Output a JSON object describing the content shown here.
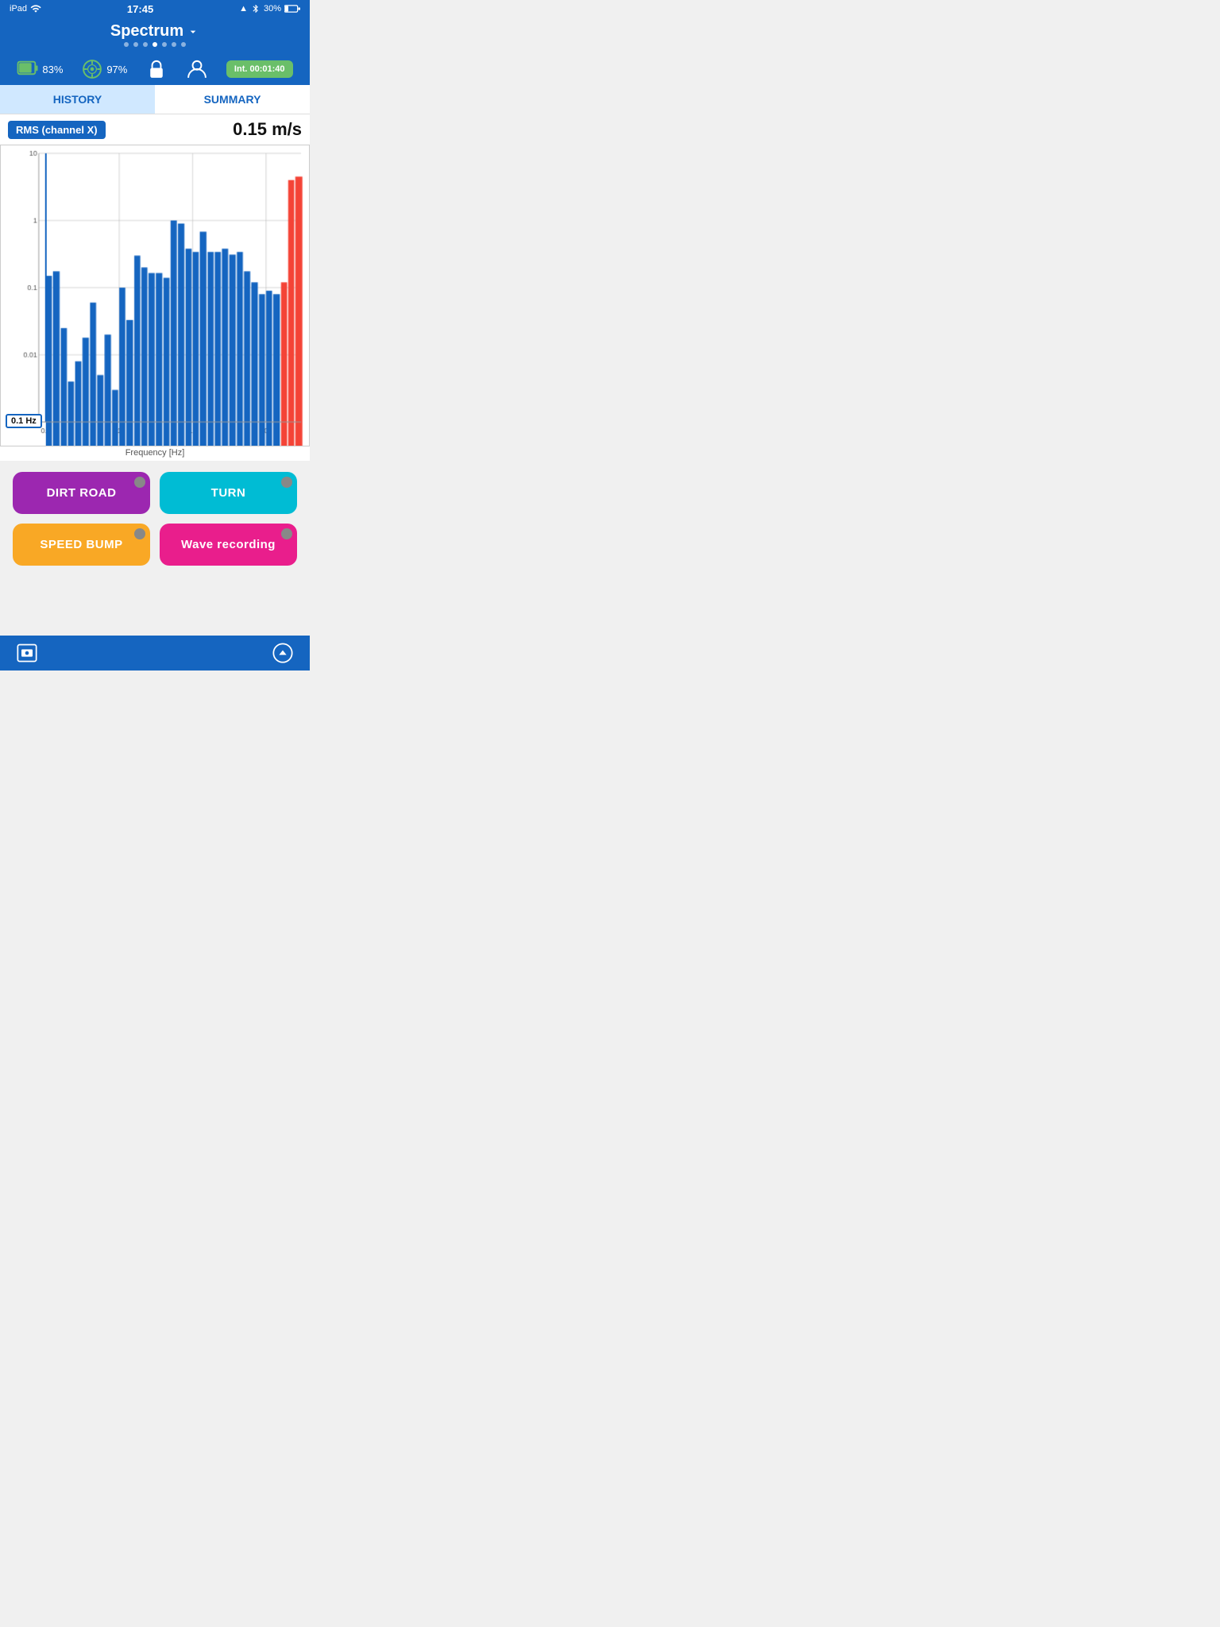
{
  "statusBar": {
    "device": "iPad",
    "wifi": "wifi",
    "time": "17:45",
    "location": "▲",
    "bluetooth": "bluetooth",
    "battery": "30%"
  },
  "header": {
    "title": "Spectrum",
    "chevron": "chevron-down",
    "dots": [
      false,
      false,
      false,
      true,
      false,
      false,
      false
    ]
  },
  "iconsBar": {
    "battery": "83%",
    "gps": "97%",
    "interval": "Int. 00:01:40"
  },
  "tabs": [
    {
      "id": "history",
      "label": "HISTORY",
      "active": true
    },
    {
      "id": "summary",
      "label": "SUMMARY",
      "active": false
    }
  ],
  "chart": {
    "rmsBadge": "RMS (channel X)",
    "rmsValue": "0.15 m/s",
    "yAxis": [
      "10.0",
      "1.0",
      "0.1",
      "0.01",
      "0.001"
    ],
    "xAxisLabel": "Frequency [Hz]",
    "xAxisTicks": [
      "0.1",
      "1.0",
      "10.0",
      "100.0"
    ],
    "cursorValue": "0.1 Hz",
    "bars": [
      {
        "freq": 0.1,
        "height": 0.15,
        "red": false
      },
      {
        "freq": 0.125,
        "height": 0.175,
        "red": false
      },
      {
        "freq": 0.16,
        "height": 0.025,
        "red": false
      },
      {
        "freq": 0.2,
        "height": 0.004,
        "red": false
      },
      {
        "freq": 0.25,
        "height": 0.008,
        "red": false
      },
      {
        "freq": 0.315,
        "height": 0.018,
        "red": false
      },
      {
        "freq": 0.4,
        "height": 0.06,
        "red": false
      },
      {
        "freq": 0.5,
        "height": 0.005,
        "red": false
      },
      {
        "freq": 0.63,
        "height": 0.02,
        "red": false
      },
      {
        "freq": 0.8,
        "height": 0.003,
        "red": false
      },
      {
        "freq": 1.0,
        "height": 0.1,
        "red": false
      },
      {
        "freq": 1.25,
        "height": 0.033,
        "red": false
      },
      {
        "freq": 1.6,
        "height": 0.3,
        "red": false
      },
      {
        "freq": 2.0,
        "height": 0.2,
        "red": false
      },
      {
        "freq": 2.5,
        "height": 0.165,
        "red": false
      },
      {
        "freq": 3.15,
        "height": 0.165,
        "red": false
      },
      {
        "freq": 4.0,
        "height": 0.14,
        "red": false
      },
      {
        "freq": 5.0,
        "height": 1.0,
        "red": false
      },
      {
        "freq": 6.3,
        "height": 0.9,
        "red": false
      },
      {
        "freq": 8.0,
        "height": 0.38,
        "red": false
      },
      {
        "freq": 10.0,
        "height": 0.34,
        "red": false
      },
      {
        "freq": 12.5,
        "height": 0.68,
        "red": false
      },
      {
        "freq": 16.0,
        "height": 0.34,
        "red": false
      },
      {
        "freq": 20.0,
        "height": 0.34,
        "red": false
      },
      {
        "freq": 25.0,
        "height": 0.38,
        "red": false
      },
      {
        "freq": 31.5,
        "height": 0.31,
        "red": false
      },
      {
        "freq": 40.0,
        "height": 0.34,
        "red": false
      },
      {
        "freq": 50.0,
        "height": 0.175,
        "red": false
      },
      {
        "freq": 63.0,
        "height": 0.12,
        "red": false
      },
      {
        "freq": 80.0,
        "height": 0.08,
        "red": false
      },
      {
        "freq": 100.0,
        "height": 0.09,
        "red": false
      },
      {
        "freq": 125.0,
        "height": 0.08,
        "red": false
      },
      {
        "freq": 160.0,
        "height": 0.12,
        "red": true
      },
      {
        "freq": 200.0,
        "height": 4.0,
        "red": true
      },
      {
        "freq": 250.0,
        "height": 4.5,
        "red": true
      }
    ]
  },
  "buttons": {
    "dirtRoad": "DIRT ROAD",
    "turn": "TURN",
    "speedBump": "SPEED BUMP",
    "waveRecording": "Wave recording"
  }
}
